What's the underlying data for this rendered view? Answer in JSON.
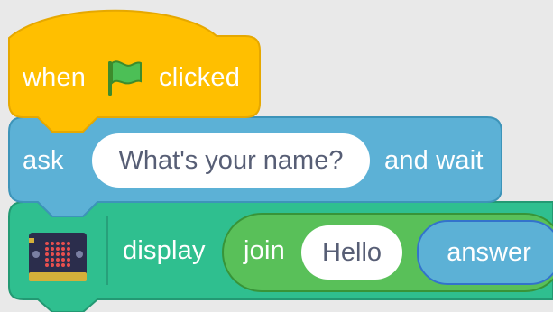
{
  "hat_block": {
    "text_when": "when",
    "text_clicked": "clicked",
    "icon": "green-flag-icon",
    "color": "#ffbf00"
  },
  "ask_block": {
    "text_ask": "ask",
    "input_value": "What's your name?",
    "text_and_wait": "and wait",
    "color": "#5cb1d6"
  },
  "display_block": {
    "icon": "microbit-icon",
    "text_display": "display",
    "join": {
      "label": "join",
      "input_value": "Hello",
      "answer_label": "answer"
    },
    "color": "#2fbf8f"
  }
}
